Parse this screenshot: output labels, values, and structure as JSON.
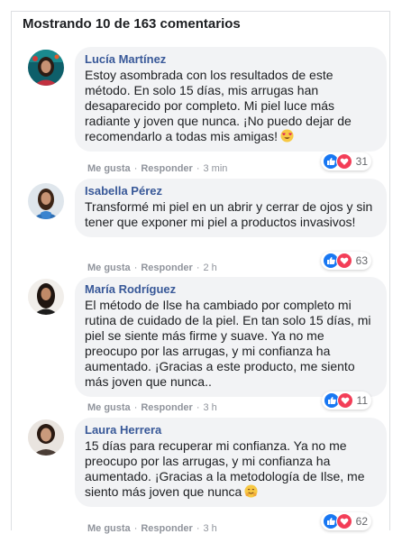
{
  "header": {
    "title": "Mostrando 10 de 163 comentarios"
  },
  "colors": {
    "name": "#385898",
    "bubble": "#f2f3f5",
    "like": "#1877f2",
    "love": "#f33e58",
    "meta": "#90949c"
  },
  "actions": {
    "like_label": "Me gusta",
    "reply_label": "Responder",
    "separator": "·"
  },
  "comments": [
    {
      "name": "Lucía Martínez",
      "text": "Estoy asombrada con los resultados de este método. En solo 15 días, mis arrugas han desaparecido por completo. Mi piel luce más radiante y joven que nunca. ¡No puedo dejar de recomendarlo a todas mis amigas!",
      "emoji": "heart-eyes-emoji",
      "time": "3 min",
      "reactions": "31"
    },
    {
      "name": "Isabella Pérez",
      "text": "Transformé mi piel en un abrir y cerrar de ojos y sin tener que exponer mi piel a productos invasivos!",
      "time": "2 h",
      "reactions": "63"
    },
    {
      "name": "María Rodríguez",
      "text": "El método de Ilse ha cambiado por completo mi rutina de cuidado de la piel. En tan solo 15 días, mi piel se siente más firme y suave. Ya no me preocupo por las arrugas, y mi confianza ha aumentado. ¡Gracias a este producto, me siento más joven que nunca..",
      "time": "3 h",
      "reactions": "11"
    },
    {
      "name": "Laura Herrera",
      "text": "15 días para recuperar mi confianza. Ya no me preocupo por las arrugas, y mi confianza ha aumentado. ¡Gracias a la metodología de Ilse, me siento más joven que nunca",
      "emoji": "hug-emoji",
      "time": "3 h",
      "reactions": "62"
    }
  ]
}
